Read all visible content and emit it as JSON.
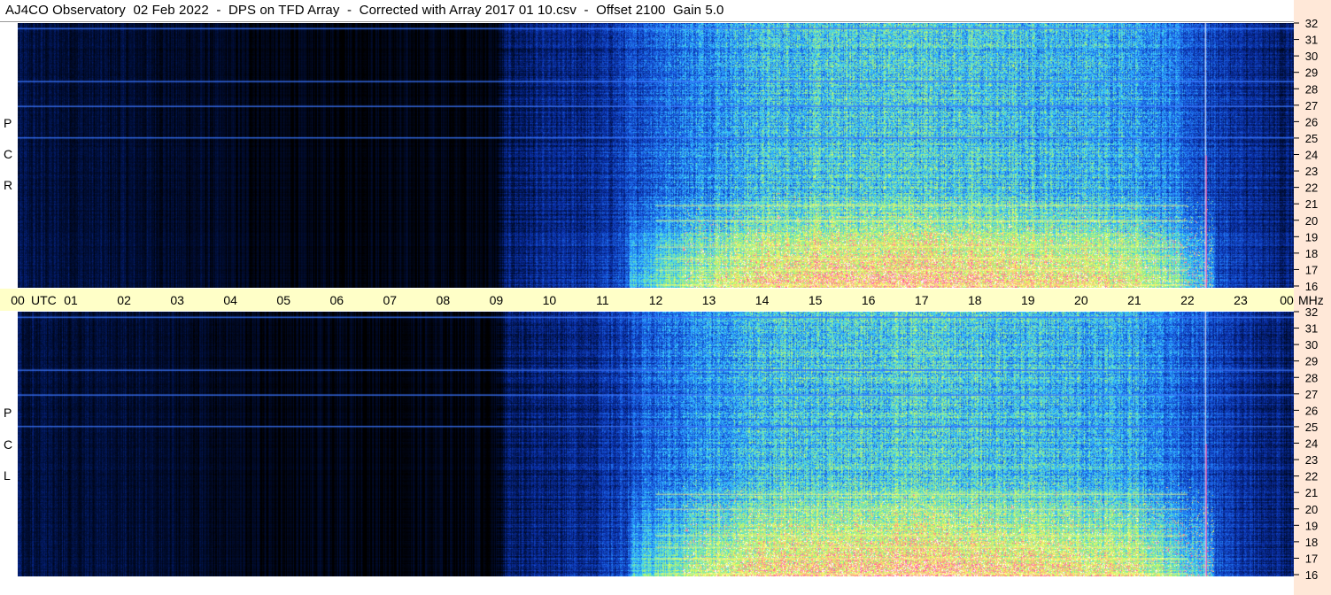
{
  "title": "AJ4CO Observatory  02 Feb 2022  -  DPS on TFD Array  -  Corrected with Array 2017 01 10.csv  -  Offset 2100  Gain 5.0",
  "chart_data": {
    "type": "heatmap",
    "title": "AJ4CO Observatory  02 Feb 2022  -  DPS on TFD Array  -  Corrected with Array 2017 01 10.csv  -  Offset 2100  Gain 5.0",
    "xlabel": "UTC",
    "ylabel": "MHz",
    "x_ticks": [
      "00",
      "01",
      "02",
      "03",
      "04",
      "05",
      "06",
      "07",
      "08",
      "09",
      "10",
      "11",
      "12",
      "13",
      "14",
      "15",
      "16",
      "17",
      "18",
      "19",
      "20",
      "21",
      "22",
      "23",
      "00"
    ],
    "xlim": [
      0,
      24
    ],
    "ylim": [
      16,
      32
    ],
    "y_ticks": [
      16,
      17,
      18,
      19,
      20,
      21,
      22,
      23,
      24,
      25,
      26,
      27,
      28,
      29,
      30,
      31,
      32
    ],
    "panels": [
      {
        "name": "R C P",
        "polarization": "RCP"
      },
      {
        "name": "L C P",
        "polarization": "LCP"
      }
    ],
    "colormap": [
      "#000000",
      "#001040",
      "#0a2fa8",
      "#1e6cf0",
      "#3ad0ff",
      "#9cf07a",
      "#ffff60",
      "#ff4fa0",
      "#ffffff"
    ],
    "intensity_profile_by_hour": [
      {
        "hour": 0,
        "level": 0.18
      },
      {
        "hour": 3,
        "level": 0.12
      },
      {
        "hour": 5,
        "level": 0.05
      },
      {
        "hour": 9,
        "level": 0.05
      },
      {
        "hour": 9.2,
        "level": 0.25
      },
      {
        "hour": 11,
        "level": 0.35
      },
      {
        "hour": 12,
        "level": 0.55
      },
      {
        "hour": 14,
        "level": 0.75
      },
      {
        "hour": 17,
        "level": 0.8
      },
      {
        "hour": 21,
        "level": 0.7
      },
      {
        "hour": 23,
        "level": 0.35
      },
      {
        "hour": 24,
        "level": 0.25
      }
    ],
    "interference_lines_mhz": [
      16.2,
      17.1,
      17.8,
      18.5,
      20.1,
      21.0,
      25.1,
      27.0,
      28.5,
      31.7
    ],
    "vertical_spike_hour": 22.33
  }
}
